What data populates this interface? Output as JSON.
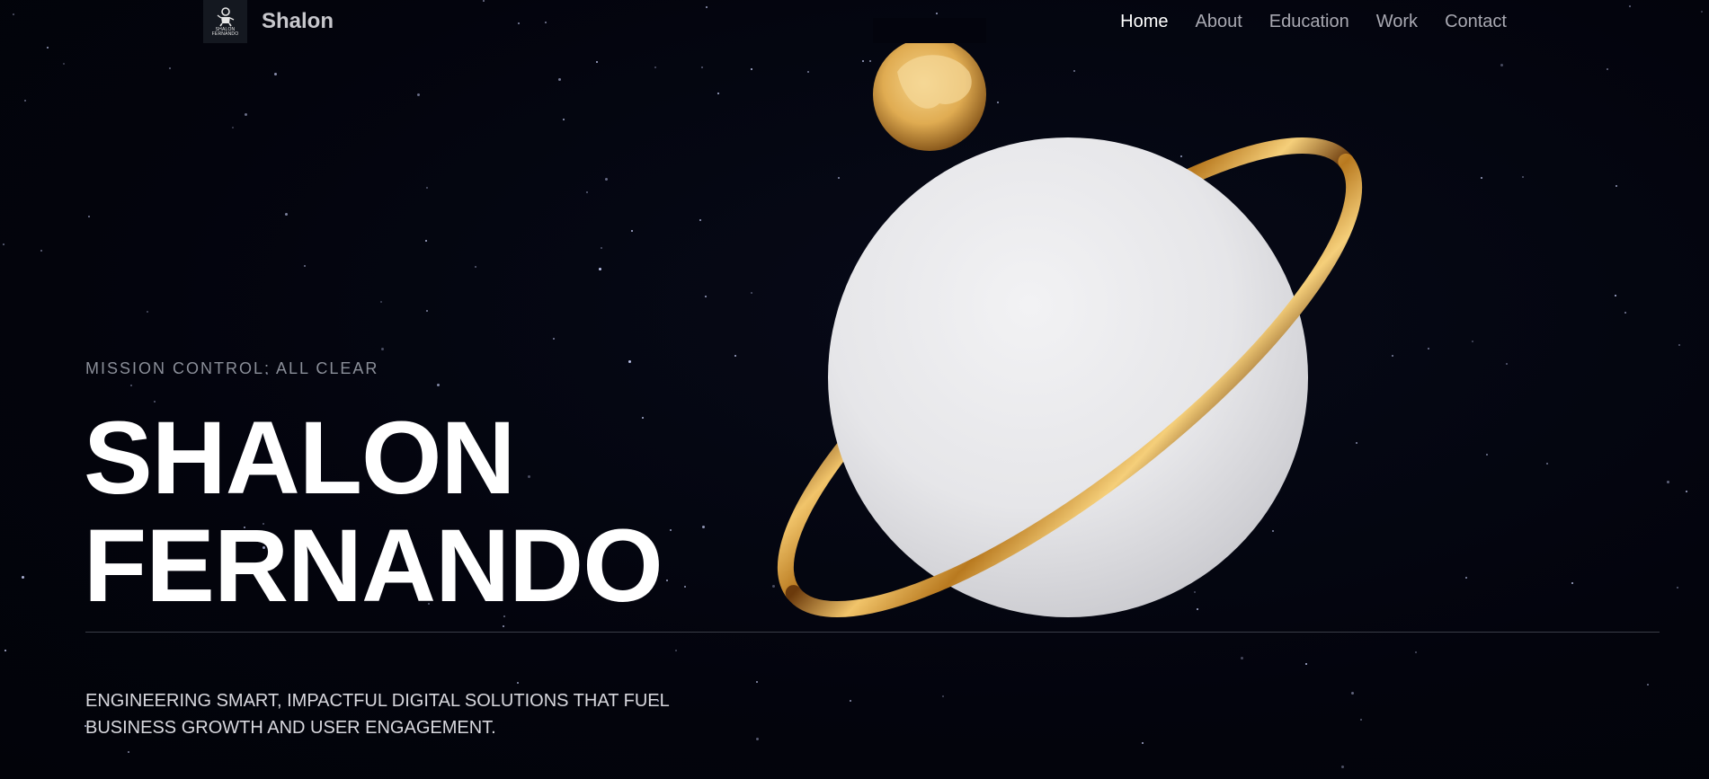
{
  "header": {
    "logo_text": "SHALON FERNANDO",
    "brand_name": "Shalon",
    "nav": [
      {
        "label": "Home",
        "active": true
      },
      {
        "label": "About",
        "active": false
      },
      {
        "label": "Education",
        "active": false
      },
      {
        "label": "Work",
        "active": false
      },
      {
        "label": "Contact",
        "active": false
      }
    ]
  },
  "hero": {
    "status": "MISSION CONTROL: ALL CLEAR",
    "name_line1": "SHALON",
    "name_line2": "FERNANDO",
    "tagline": "ENGINEERING SMART, IMPACTFUL DIGITAL SOLUTIONS THAT FUEL BUSINESS GROWTH AND USER ENGAGEMENT."
  },
  "colors": {
    "background": "#03040d",
    "planet": "#e9e9ec",
    "ring_gold": "#d9a441",
    "moon_gold": "#e8bf6a",
    "nav_active": "#ffffff",
    "nav_inactive": "#a9a9b2"
  }
}
